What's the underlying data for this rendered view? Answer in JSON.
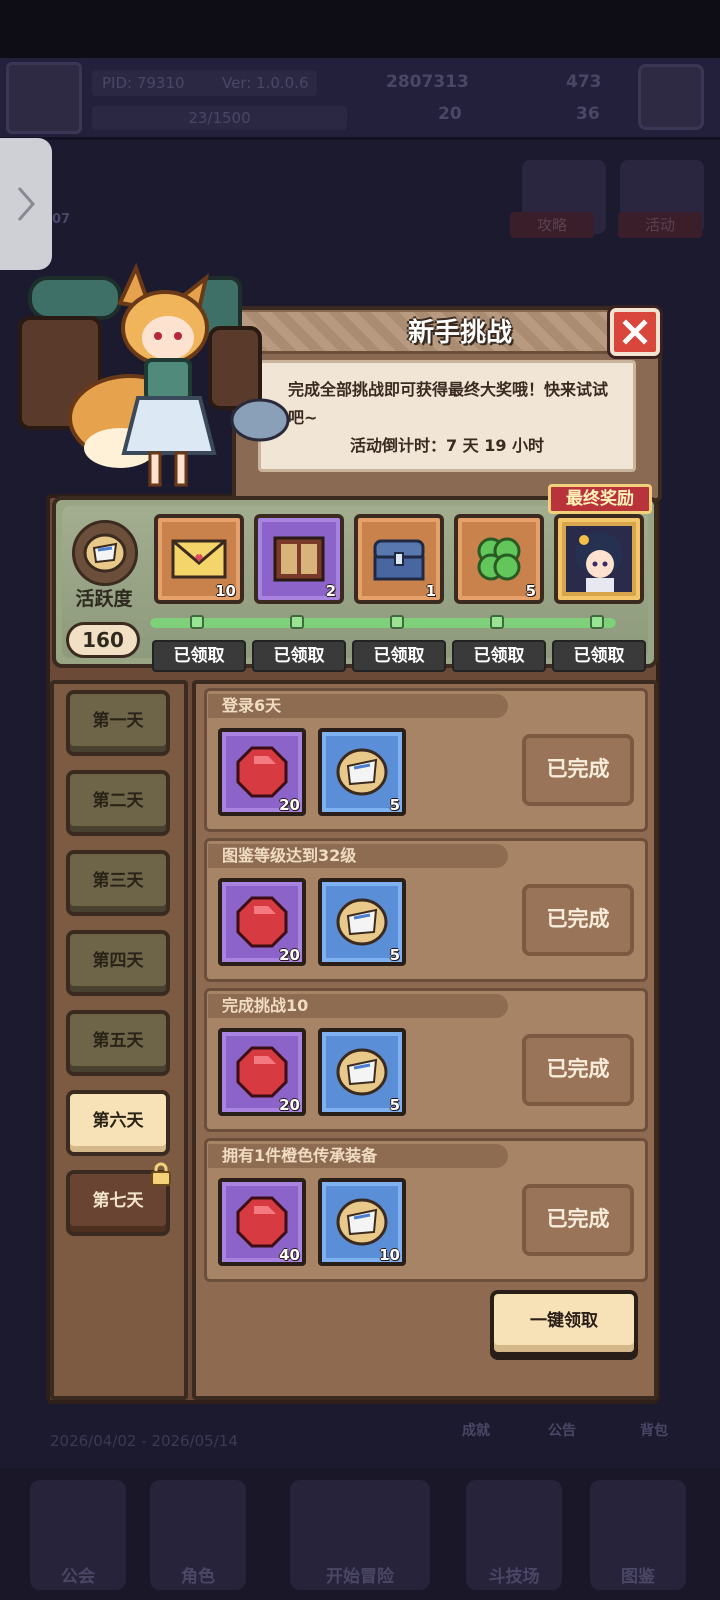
{
  "background": {
    "pid": "PID: 79310",
    "version": "Ver: 1.0.0.6",
    "exp": "23/1500",
    "gold": "2807313",
    "gems": "473",
    "clover": "20",
    "stamina": "36",
    "side_date": "07",
    "buttons": [
      "攻略",
      "活动"
    ],
    "dates": "2026/04/02 - 2026/05/14",
    "nav": [
      "公会",
      "角色",
      "开始冒险",
      "斗技场",
      "图鉴"
    ],
    "side_nav": [
      "成就",
      "公告",
      "背包"
    ]
  },
  "panel": {
    "title": "新手挑战",
    "description": "完成全部挑战即可获得最终大奖哦！快来试试吧~",
    "countdown": "活动倒计时：7 天 19 小时"
  },
  "activity": {
    "label": "活跃度",
    "value": "160",
    "progress": 1.0
  },
  "rewards": {
    "final_label": "最终奖励",
    "items": [
      {
        "icon": "letter-icon",
        "count": "10",
        "status": "已领取"
      },
      {
        "icon": "book-icon",
        "count": "2",
        "status": "已领取"
      },
      {
        "icon": "chest-icon",
        "count": "1",
        "status": "已领取"
      },
      {
        "icon": "clover-icon",
        "count": "5",
        "status": "已领取"
      },
      {
        "icon": "character-portrait-icon",
        "count": "",
        "status": "已领取"
      }
    ]
  },
  "days": [
    {
      "label": "第一天",
      "state": "normal"
    },
    {
      "label": "第二天",
      "state": "normal"
    },
    {
      "label": "第三天",
      "state": "normal"
    },
    {
      "label": "第四天",
      "state": "normal"
    },
    {
      "label": "第五天",
      "state": "normal"
    },
    {
      "label": "第六天",
      "state": "active"
    },
    {
      "label": "第七天",
      "state": "locked"
    }
  ],
  "tasks": [
    {
      "title": "登录6天",
      "gem_count": "20",
      "scroll_count": "5",
      "status": "已完成"
    },
    {
      "title": "图鉴等级达到32级",
      "gem_count": "20",
      "scroll_count": "5",
      "status": "已完成"
    },
    {
      "title": "完成挑战10",
      "gem_count": "20",
      "scroll_count": "5",
      "status": "已完成"
    },
    {
      "title": "拥有1件橙色传承装备",
      "gem_count": "40",
      "scroll_count": "10",
      "status": "已完成"
    }
  ],
  "claim_all": "一键领取",
  "colors": {
    "panel": "#6b4b38",
    "active_tab": "#f6e2b6",
    "close": "#d8463c",
    "final_tag": "#b8343a"
  }
}
